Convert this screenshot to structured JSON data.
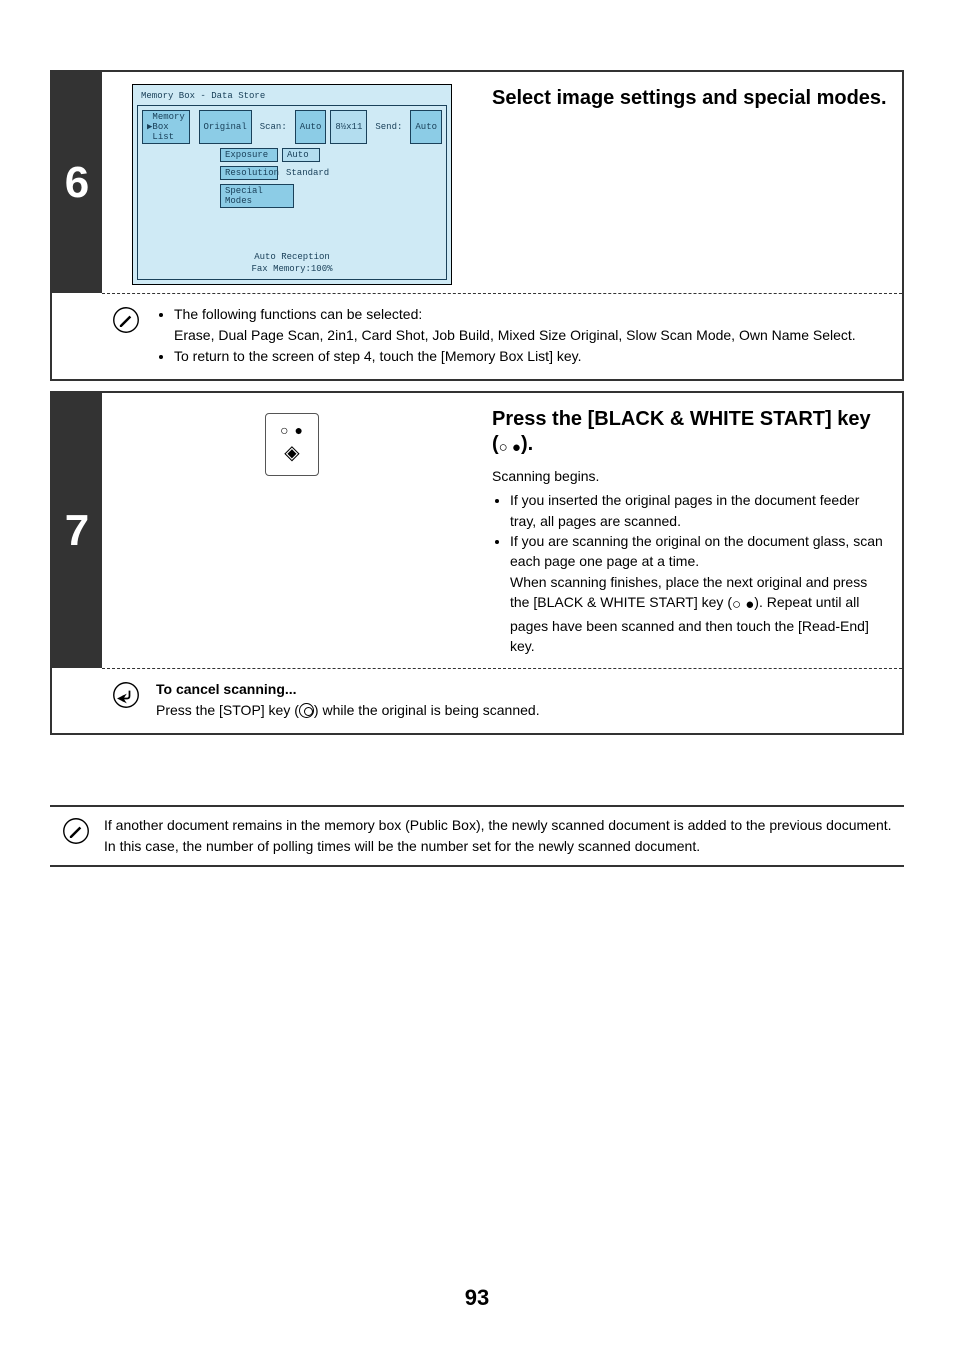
{
  "step6": {
    "number": "6",
    "heading": "Select image settings and special modes.",
    "screen": {
      "title": "Memory Box - Data Store",
      "list_button": "Memory Box List",
      "row1": {
        "original": "Original",
        "scan_label": "Scan:",
        "scan_val": "Auto",
        "size": "8½x11",
        "send_label": "Send:",
        "send_val": "Auto"
      },
      "row2": {
        "label": "Exposure",
        "val": "Auto"
      },
      "row3": {
        "label": "Resolution",
        "val": "Standard"
      },
      "row4": {
        "label": "Special Modes"
      },
      "footer_line1": "Auto Reception",
      "footer_line2": "Fax Memory:100%"
    },
    "note": {
      "line1": "The following functions can be selected:",
      "line1_sub": "Erase, Dual Page Scan, 2in1, Card Shot, Job Build, Mixed Size Original, Slow Scan Mode, Own Name Select.",
      "line2": "To return to the screen of step 4, touch the [Memory Box List] key."
    }
  },
  "step7": {
    "number": "7",
    "heading_a": "Press the [BLACK & WHITE START] key (",
    "heading_b": ").",
    "body_line1": "Scanning begins.",
    "bullet1": "If you inserted the original pages in the document feeder tray, all pages are scanned.",
    "bullet2a": "If you are scanning the original on the document glass, scan each page one page at a time.",
    "bullet2b": "When scanning finishes, place the next original and press the [BLACK & WHITE START] key (",
    "bullet2c": "). Repeat until all pages have been scanned and then touch the [Read-End] key.",
    "note": {
      "title": "To cancel scanning...",
      "text_a": "Press the [STOP] key (",
      "text_b": ") while the original is being scanned."
    }
  },
  "bottom_note": "If another document remains in the memory box (Public Box), the newly scanned document is added to the previous document. In this case, the number of polling times will be the number set for the newly scanned document.",
  "page_number": "93"
}
